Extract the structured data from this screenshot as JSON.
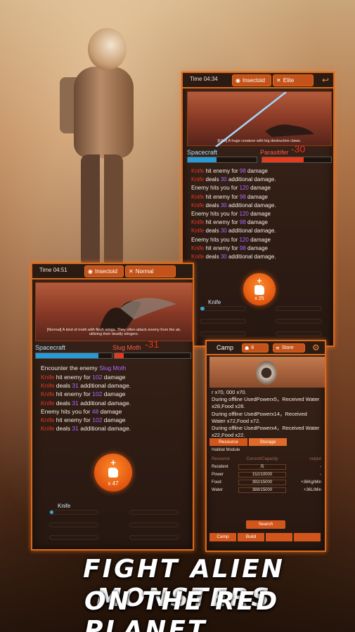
{
  "headline": {
    "line1": "FIGHT ALIEN MONSTERS",
    "line2": "ON THE RED PLANET"
  },
  "battle_elite": {
    "time_label": "Time 04:34",
    "enemy_type": "Insectoid",
    "difficulty": "Elite",
    "scene_caption": "[Elite] A huge creature with big destructive claws.",
    "player_name": "Spacecraft",
    "player_hp": 0.42,
    "enemy_name": "Parasitifer",
    "enemy_hp": 0.6,
    "damage_popup": "-30",
    "log": [
      {
        "a": "Knife",
        "b": " hit enemy for ",
        "n": "98",
        "c": " damage"
      },
      {
        "a": "Knife",
        "b": " deals ",
        "n": "30",
        "c": " additional damage."
      },
      {
        "a": "",
        "b": "Enemy hits you for ",
        "n": "120",
        "c": " damage"
      },
      {
        "a": "Knife",
        "b": " hit enemy for ",
        "n": "98",
        "c": " damage"
      },
      {
        "a": "Knife",
        "b": " deals ",
        "n": "30",
        "c": " additional damage."
      },
      {
        "a": "",
        "b": "Enemy hits you for ",
        "n": "120",
        "c": " damage"
      },
      {
        "a": "Knife",
        "b": " hit enemy for ",
        "n": "98",
        "c": " damage"
      },
      {
        "a": "Knife",
        "b": " deals ",
        "n": "30",
        "c": " additional damage."
      },
      {
        "a": "",
        "b": "Enemy hits you for ",
        "n": "120",
        "c": " damage"
      },
      {
        "a": "Knife",
        "b": " hit enemy for ",
        "n": "98",
        "c": " damage"
      },
      {
        "a": "Knife",
        "b": " deals ",
        "n": "30",
        "c": " additional damage."
      }
    ],
    "attack_plus": "+",
    "attack_count": "x 25",
    "weapon": "Knife",
    "weapon_progress": 0.1
  },
  "battle_normal": {
    "time_label": "Time 04:51",
    "enemy_type": "Insectoid",
    "difficulty": "Normal",
    "scene_caption": "[Normal] A kind of moth with flesh wings. They often attack enemy from the air, utilizing their deadly stingers.",
    "player_name": "Spacecraft",
    "player_hp": 0.82,
    "enemy_name": "Slug Moth",
    "enemy_hp": 0.12,
    "damage_popup": "-31",
    "encounter_prefix": "Encounter the enemy ",
    "encounter_enemy": "Slug Moth",
    "log": [
      {
        "a": "Knife",
        "b": " hit enemy for ",
        "n": "102",
        "c": " damage"
      },
      {
        "a": "Knife",
        "b": " deals ",
        "n": "31",
        "c": " additional damage."
      },
      {
        "a": "Knife",
        "b": " hit enemy for ",
        "n": "102",
        "c": " damage"
      },
      {
        "a": "Knife",
        "b": " deals ",
        "n": "31",
        "c": " additional damage."
      },
      {
        "a": "",
        "b": "Enemy hits you for ",
        "n": "48",
        "c": " damage"
      },
      {
        "a": "Knife",
        "b": " hit enemy for ",
        "n": "102",
        "c": " damage"
      },
      {
        "a": "Knife",
        "b": " deals ",
        "n": "31",
        "c": " additional damage."
      }
    ],
    "attack_plus": "+",
    "attack_count": "x 47",
    "weapon": "Knife",
    "weapon_progress": 0.08
  },
  "camp": {
    "title": "Camp",
    "pill1": "8",
    "pill2": "Store",
    "log": [
      "r x70, 000 x70.",
      "During offline UsedPowerx5，Received Water x28,Food x28.",
      "During offline UsedPowerx14，Received Water x72,Food x72.",
      "During offline UsedPowerx4，Received Water x22,Food x22."
    ],
    "tabs": [
      "Resource",
      "Storage"
    ],
    "module_title": "Habitat Module",
    "table_header": [
      "Resource",
      "Current/Capacity",
      "output"
    ],
    "rows": [
      {
        "name": "Resident",
        "value": "/5",
        "output": "-"
      },
      {
        "name": "Power",
        "value": "152/10000",
        "output": "-"
      },
      {
        "name": "Food",
        "value": "392/15000",
        "output": "+36Kg/Min"
      },
      {
        "name": "Water",
        "value": "388/15000",
        "output": "+36L/Min"
      }
    ],
    "search_label": "Search",
    "bottom_tabs": [
      "Camp",
      "Build",
      "",
      ""
    ]
  }
}
